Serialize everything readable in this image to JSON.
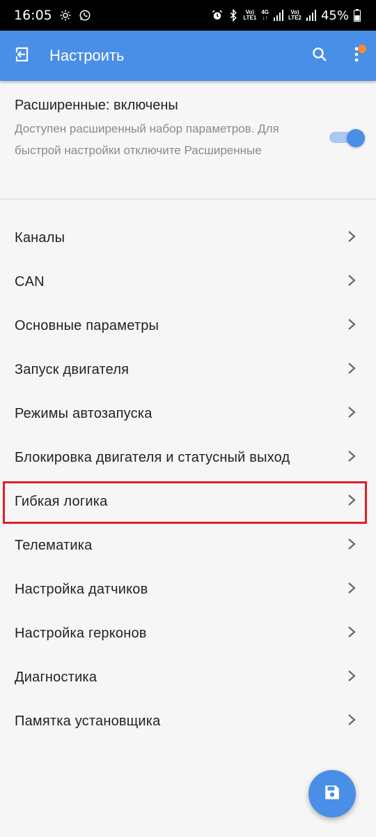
{
  "status_bar": {
    "time": "16:05",
    "battery": "45%",
    "sim1_label_top": "Vo)",
    "sim1_label_bottom": "LTE1",
    "net_label_top": "4G",
    "net_label_bottom": "↓↑",
    "sim2_label_top": "Vo)",
    "sim2_label_bottom": "LTE2",
    "icons": [
      "gear-icon",
      "whatsapp-icon",
      "alarm-icon",
      "bluetooth-icon",
      "signal-icon",
      "battery-icon"
    ]
  },
  "app_bar": {
    "title": "Настроить",
    "icons": [
      "exit-icon",
      "search-icon",
      "more-vert-icon"
    ],
    "accent_color": "#4a8fe7",
    "notification_dot_color": "#ff8a2a"
  },
  "advanced": {
    "title": "Расширенные: включены",
    "description": "Доступен расширенный набор параметров. Для быстрой настройки отключите Расширенные",
    "enabled": true
  },
  "menu": {
    "items": [
      {
        "label": "Каналы"
      },
      {
        "label": "CAN"
      },
      {
        "label": "Основные параметры"
      },
      {
        "label": "Запуск двигателя"
      },
      {
        "label": "Режимы автозапуска"
      },
      {
        "label": "Блокировка двигателя и статусный выход"
      },
      {
        "label": "Гибкая логика"
      },
      {
        "label": "Телематика"
      },
      {
        "label": "Настройка датчиков"
      },
      {
        "label": "Настройка герконов"
      },
      {
        "label": "Диагностика"
      },
      {
        "label": "Памятка установщика"
      }
    ],
    "highlighted_index": 6,
    "highlight_color": "#e01e2a"
  },
  "fab": {
    "icon": "save-icon"
  }
}
